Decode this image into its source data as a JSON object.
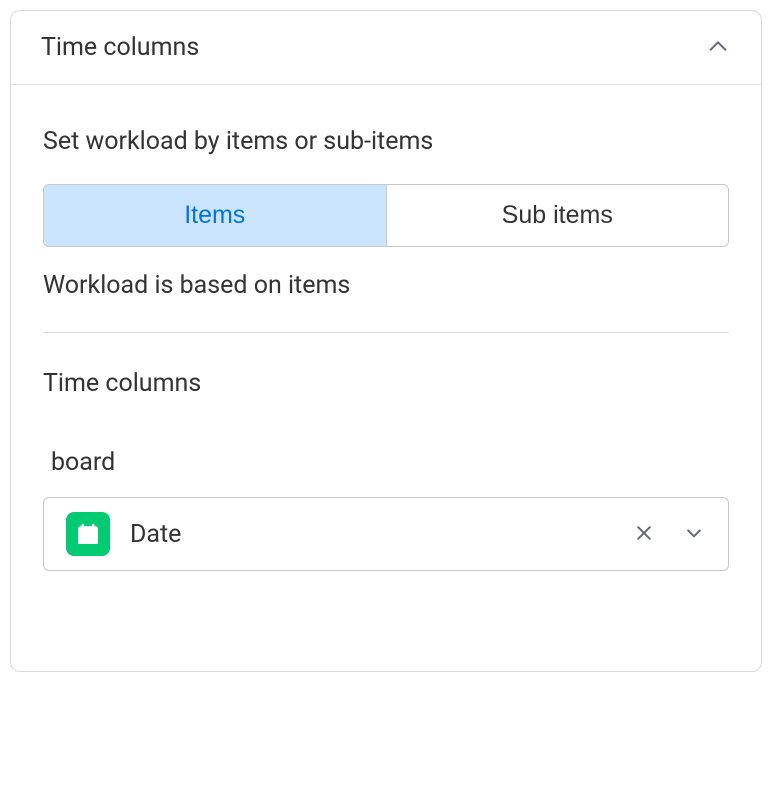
{
  "panel": {
    "title": "Time columns"
  },
  "workload": {
    "title": "Set workload by items or sub-items",
    "tabs": {
      "items": "Items",
      "sub_items": "Sub items"
    },
    "help_text": "Workload is based on items"
  },
  "time_columns": {
    "title": "Time columns",
    "field_label": "board",
    "select": {
      "icon": "calendar-icon",
      "value": "Date"
    }
  },
  "icons": {
    "calendar_bg": "#00ca72"
  }
}
